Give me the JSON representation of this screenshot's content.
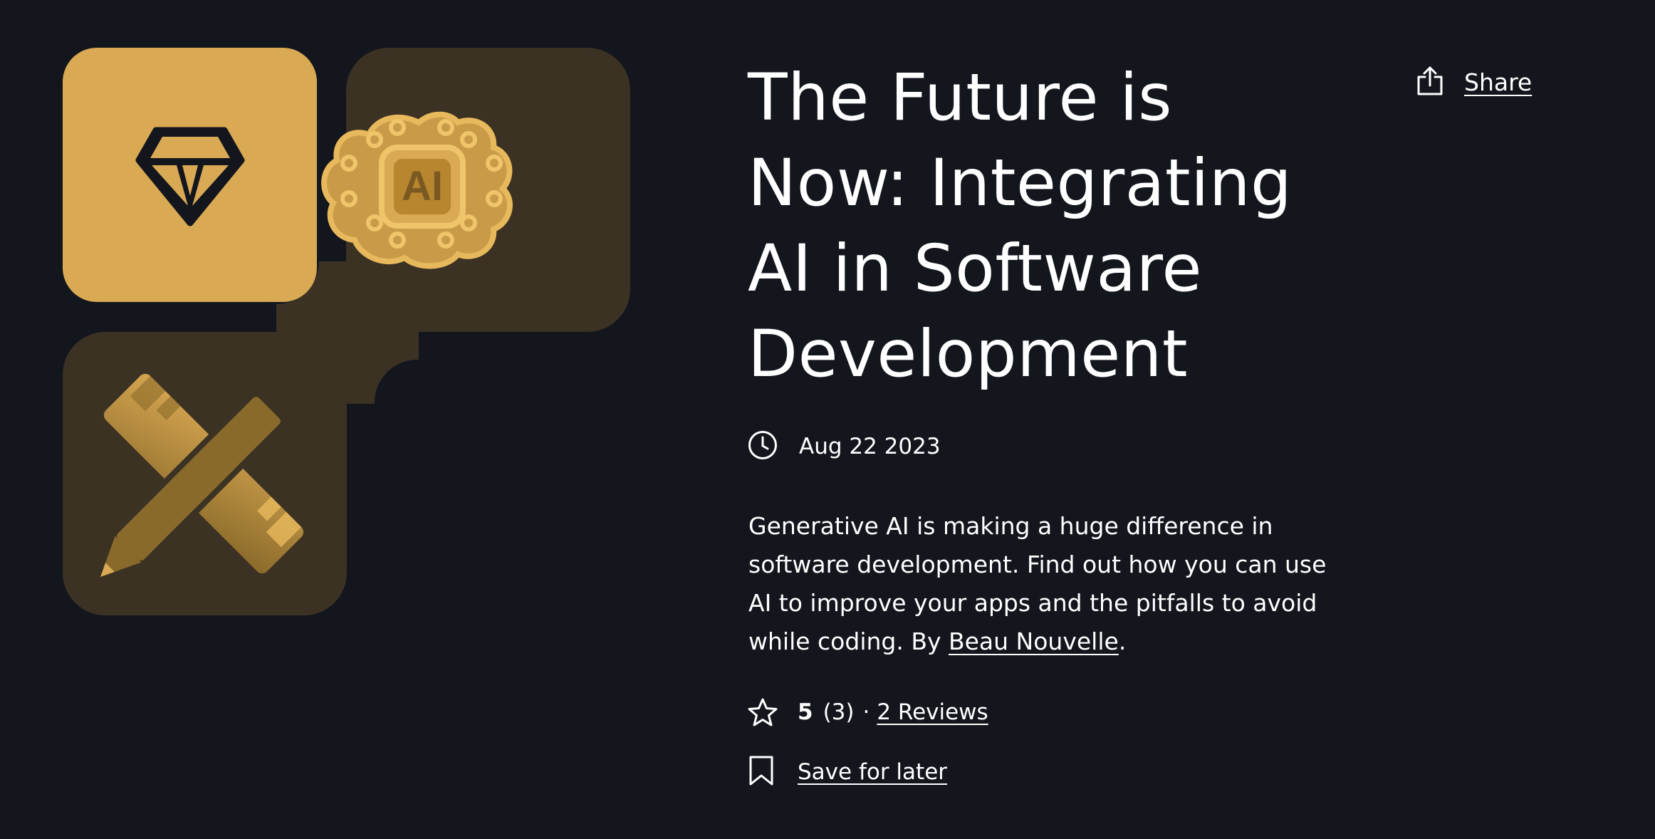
{
  "article": {
    "title": "The Future is Now: Integrating AI in Software Development",
    "date": "Aug 22 2023",
    "description": "Generative AI is making a huge difference in software development. Find out how you can use AI to improve your apps and the pitfalls to avoid while coding. By ",
    "author": "Beau Nouvelle",
    "description_end": "."
  },
  "hero": {
    "chip_label": "AI",
    "icons": [
      "diamond-icon",
      "ai-brain-chip-icon",
      "pencil-ruler-icon"
    ],
    "colors": {
      "gold": "#d9a954",
      "tile_dark": "#3b3224",
      "background": "#13161d"
    }
  },
  "share": {
    "label": "Share",
    "icon": "share-icon"
  },
  "rating": {
    "icon": "star-icon",
    "score": "5",
    "count": "(3)",
    "separator": "·",
    "reviews_label": "2 Reviews"
  },
  "save": {
    "label": "Save for later",
    "icon": "bookmark-icon"
  }
}
